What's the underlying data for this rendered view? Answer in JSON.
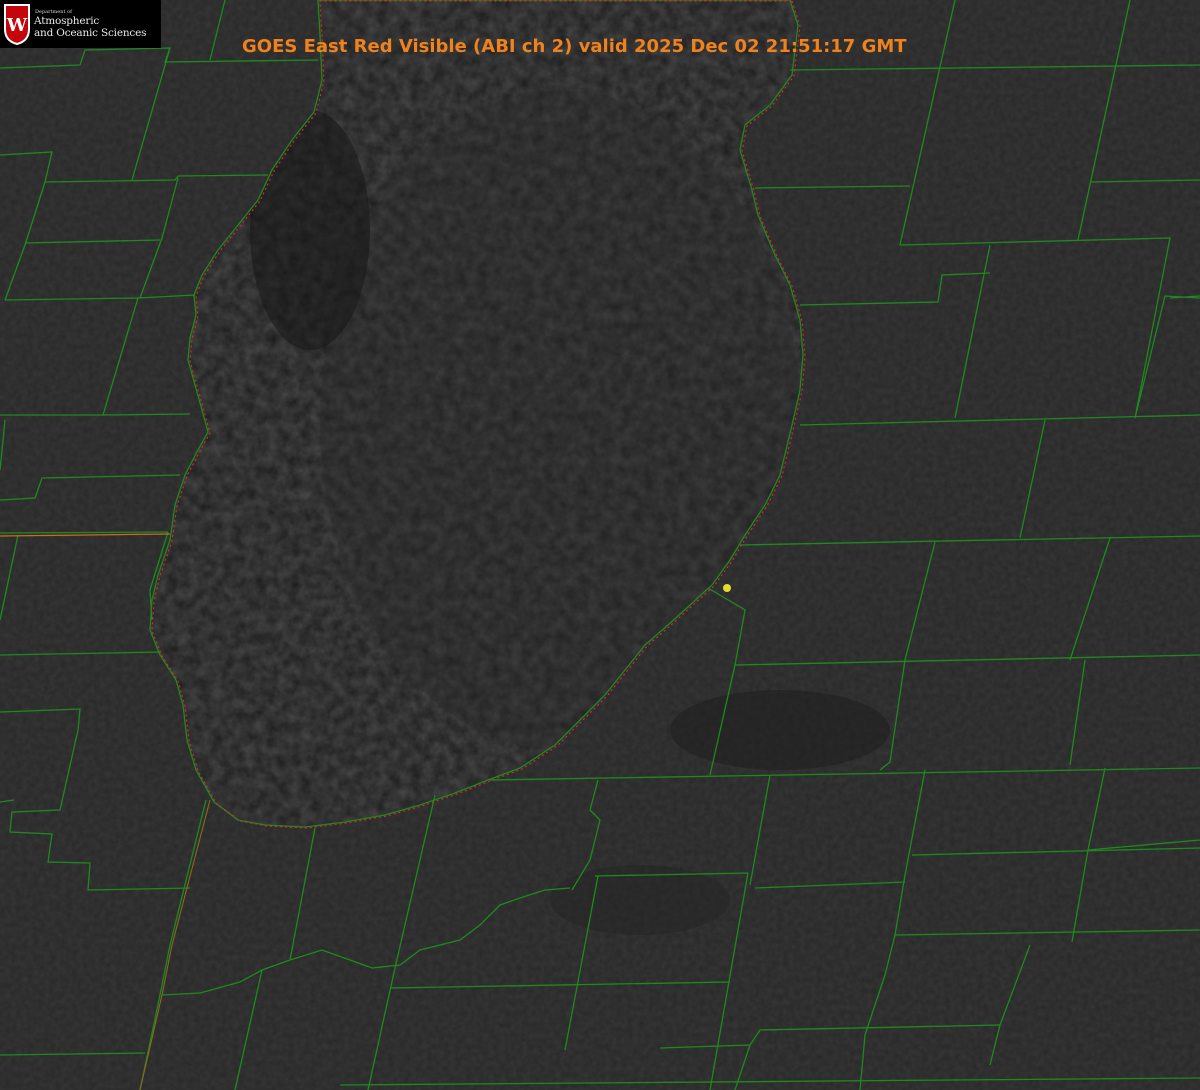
{
  "title": "GOES East Red Visible (ABI ch 2) valid 2025 Dec 02 21:51:17 GMT",
  "logo": {
    "department": "Department of",
    "line1": "Atmospheric",
    "line2": "and Oceanic Sciences",
    "crest_letter": "W"
  },
  "colors": {
    "land": "#282828",
    "lake": "#1c1c1c",
    "county_lines": "#1e8a1e",
    "state_line": "#c86e1e",
    "shoreline_dots": "#dc2828",
    "title": "#f0821e",
    "station_marker": "#e6dc28"
  },
  "map_layers": [
    "satellite-visible-imagery",
    "county-boundaries",
    "state-boundary",
    "lake-shoreline",
    "station-marker"
  ]
}
